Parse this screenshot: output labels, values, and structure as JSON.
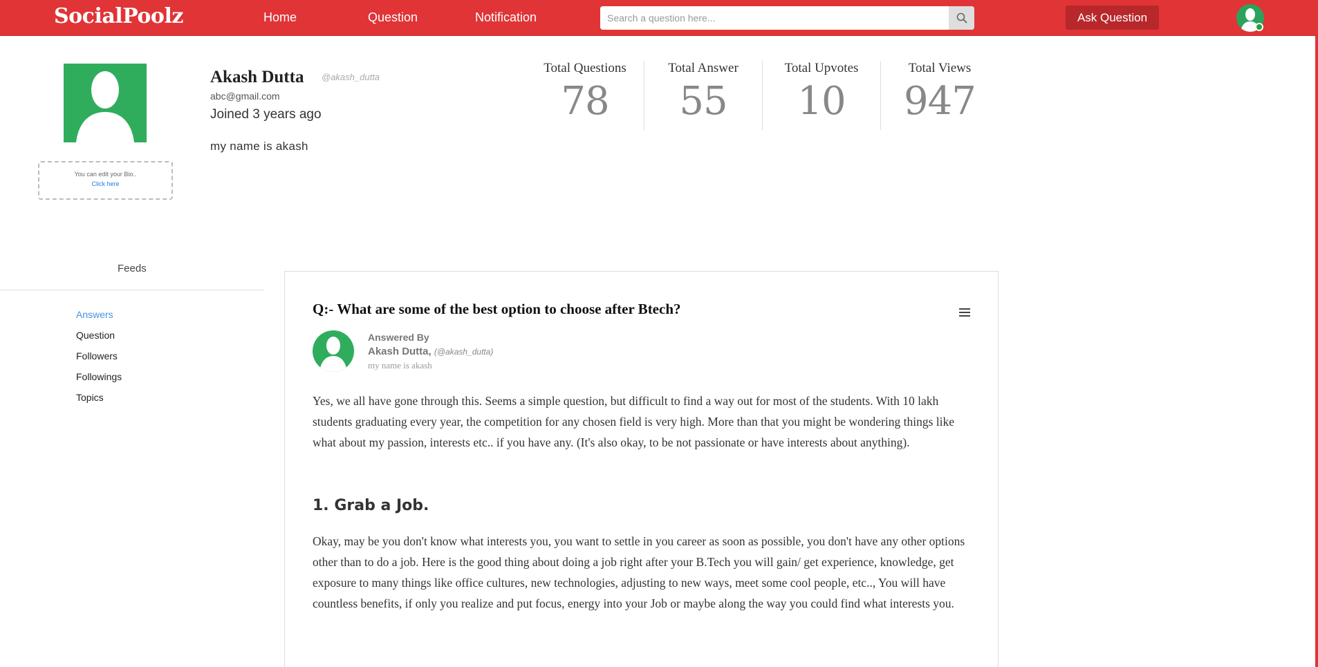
{
  "colors": {
    "brand": "#e03437",
    "ask_button": "#b8282b",
    "avatar_green": "#2fad5d",
    "active_link": "#4a90e2"
  },
  "navbar": {
    "logo": "SocialPoolz",
    "links": [
      {
        "label": "Home"
      },
      {
        "label": "Question"
      },
      {
        "label": "Notification"
      }
    ],
    "search": {
      "placeholder": "Search a question here...",
      "value": "",
      "icon": "search-icon"
    },
    "ask_button": "Ask Question",
    "avatar_icon": "user-avatar-icon"
  },
  "profile": {
    "name": "Akash Dutta",
    "handle": "@akash_dutta",
    "email": "abc@gmail.com",
    "joined": "Joined 3 years ago",
    "bio": "my name is akash",
    "bio_edit_hint": "You can edit your Bio..",
    "bio_edit_link": "Click here"
  },
  "stats": [
    {
      "label": "Total Questions",
      "value": "78"
    },
    {
      "label": "Total Answer",
      "value": "55"
    },
    {
      "label": "Total Upvotes",
      "value": "10"
    },
    {
      "label": "Total Views",
      "value": "947"
    }
  ],
  "feeds": {
    "title": "Feeds",
    "items": [
      {
        "label": "Answers",
        "active": true
      },
      {
        "label": "Question",
        "active": false
      },
      {
        "label": "Followers",
        "active": false
      },
      {
        "label": "Followings",
        "active": false
      },
      {
        "label": "Topics",
        "active": false
      }
    ]
  },
  "answer_card": {
    "question": "Q:-  What are some of the best option to choose after Btech?",
    "answered_by_label": "Answered By",
    "answerer_name": "Akash Dutta,",
    "answerer_handle": "(@akash_dutta)",
    "answerer_bio": "my name is akash",
    "paragraph1": "Yes, we all have gone through this. Seems a simple question, but difficult to find a way out for most of the students. With 10 lakh students graduating every year, the competition for any chosen field is very high. More than that you might be wondering things like what about my passion, interests etc.. if you have any. (It's also okay, to be not passionate or have interests about anything).",
    "heading1": "1. Grab a Job.",
    "paragraph2": "Okay, may be you don't know what interests you, you want to settle in you career as soon as possible, you don't have any other options other than to do a job. Here is the good thing about doing a job right after your B.Tech you will gain/ get experience, knowledge, get exposure to many things like office cultures, new technologies, adjusting to new ways, meet some cool people, etc.., You will have countless benefits, if only you realize and put focus, energy into your Job or maybe along the way you could find what interests you."
  }
}
